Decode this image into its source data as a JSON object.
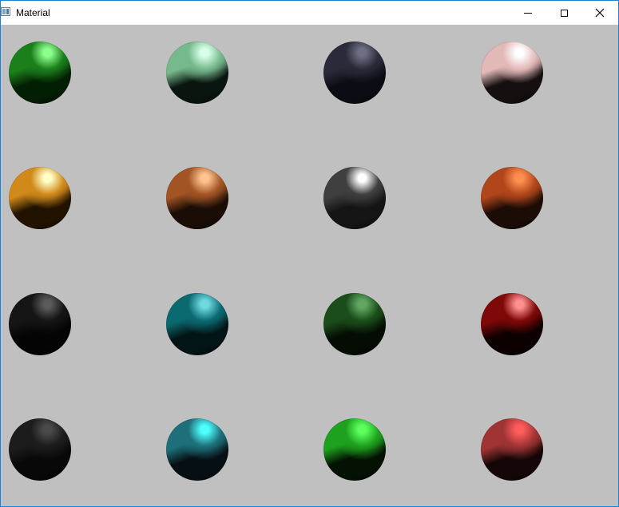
{
  "window": {
    "title": "Material",
    "icon": "app-window-icon",
    "controls": {
      "minimize_icon": "minimize-icon",
      "maximize_icon": "maximize-icon",
      "close_icon": "close-icon"
    }
  },
  "canvas": {
    "background": "#c0c0c0",
    "rows": 4,
    "columns": 4,
    "spheres": [
      {
        "hl": "#8dff8d",
        "mid": "#1b7f1b",
        "lower": "#031f03",
        "edge": "#000000"
      },
      {
        "hl": "#d8ffe8",
        "mid": "#76b98d",
        "lower": "#0a1510",
        "edge": "#050805"
      },
      {
        "hl": "#6e6e84",
        "mid": "#2a2a3a",
        "lower": "#0c0c14",
        "edge": "#050508"
      },
      {
        "hl": "#ffffff",
        "mid": "#e3b8b8",
        "lower": "#150f10",
        "edge": "#090606"
      },
      {
        "hl": "#ffffc8",
        "mid": "#d18a1a",
        "lower": "#221300",
        "edge": "#0b0500"
      },
      {
        "hl": "#ffc290",
        "mid": "#a25424",
        "lower": "#1a0d06",
        "edge": "#080402"
      },
      {
        "hl": "#ffffff",
        "mid": "#3f3f3f",
        "lower": "#141414",
        "edge": "#060606"
      },
      {
        "hl": "#ff8f50",
        "mid": "#b2461b",
        "lower": "#1c0c06",
        "edge": "#080402"
      },
      {
        "hl": "#5a5a5a",
        "mid": "#151515",
        "lower": "#040404",
        "edge": "#000000"
      },
      {
        "hl": "#6fd8e0",
        "mid": "#0b6a70",
        "lower": "#031416",
        "edge": "#000405"
      },
      {
        "hl": "#62a662",
        "mid": "#1a4d1a",
        "lower": "#040c04",
        "edge": "#000000"
      },
      {
        "hl": "#ff9090",
        "mid": "#7f0808",
        "lower": "#0c0000",
        "edge": "#000000"
      },
      {
        "hl": "#4a4a4a",
        "mid": "#1c1c1c",
        "lower": "#080808",
        "edge": "#000000"
      },
      {
        "hl": "#4dffff",
        "mid": "#1e6f7a",
        "lower": "#061014",
        "edge": "#020506"
      },
      {
        "hl": "#5cff5c",
        "mid": "#1ea11e",
        "lower": "#041204",
        "edge": "#000400"
      },
      {
        "hl": "#ff5c5c",
        "mid": "#a03434",
        "lower": "#140606",
        "edge": "#060202"
      }
    ]
  }
}
